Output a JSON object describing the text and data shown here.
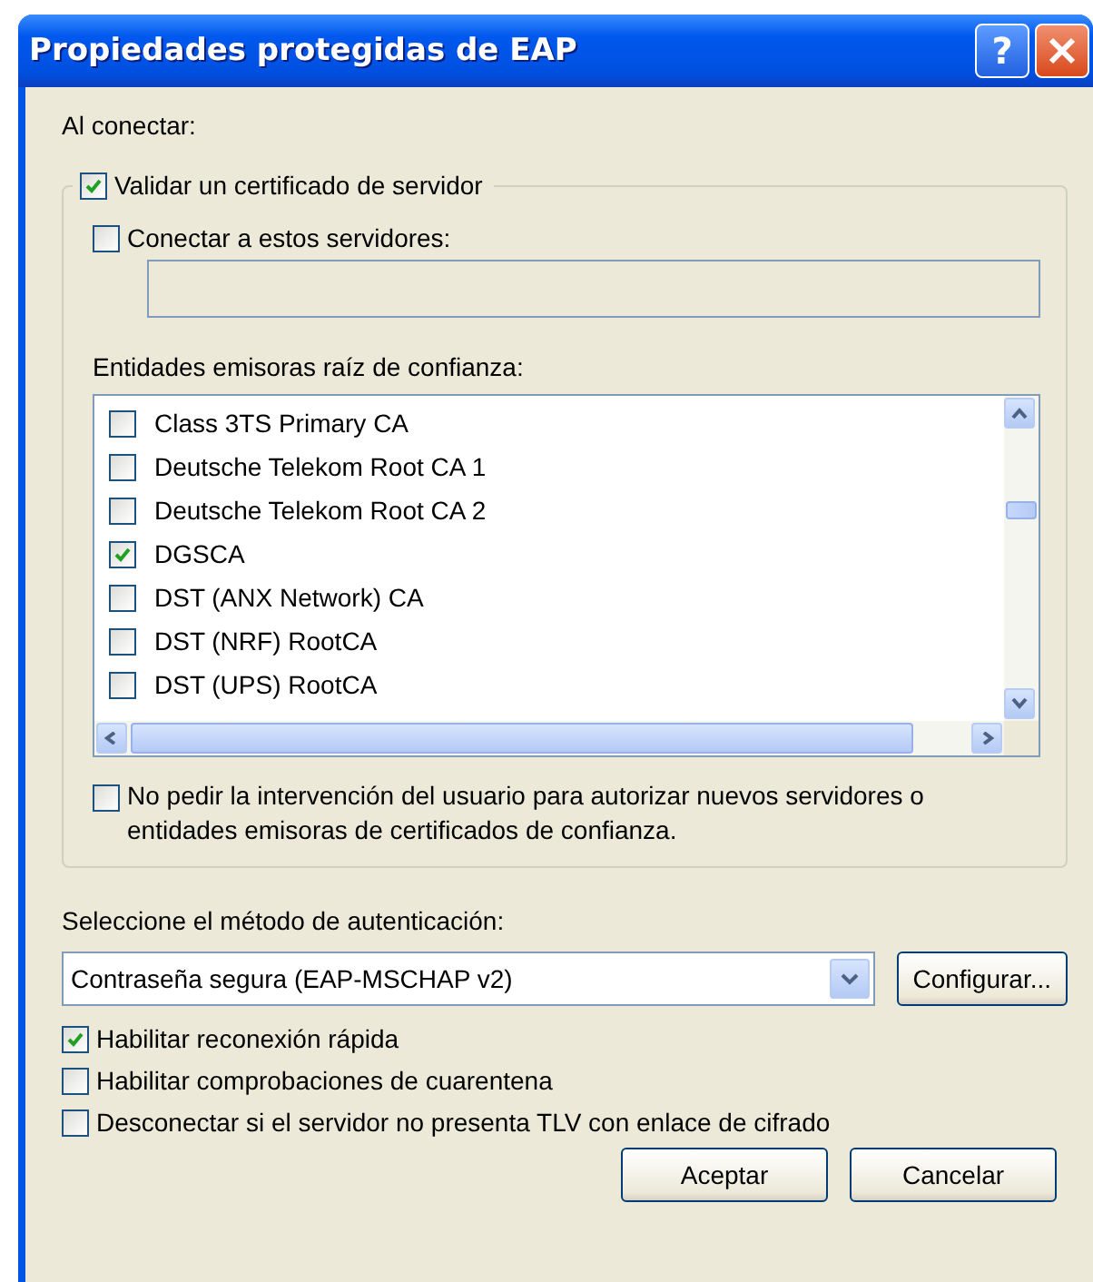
{
  "window": {
    "title": "Propiedades protegidas de EAP",
    "help_button": "?"
  },
  "on_connect_label": "Al conectar:",
  "validate_certificate": {
    "label": "Validar un certificado de servidor",
    "checked": true
  },
  "connect_servers": {
    "label": "Conectar a estos servidores:",
    "checked": false
  },
  "trusted_label": "Entidades emisoras raíz de confianza:",
  "ca_list": [
    {
      "label": "Class 3TS Primary CA",
      "checked": false
    },
    {
      "label": "Deutsche Telekom Root CA 1",
      "checked": false
    },
    {
      "label": "Deutsche Telekom Root CA 2",
      "checked": false
    },
    {
      "label": "DGSCA",
      "checked": true
    },
    {
      "label": "DST (ANX Network) CA",
      "checked": false
    },
    {
      "label": "DST (NRF) RootCA",
      "checked": false
    },
    {
      "label": "DST (UPS) RootCA",
      "checked": false
    }
  ],
  "no_prompt": {
    "label": "No pedir la intervención del usuario para autorizar nuevos servidores o entidades emisoras de certificados de confianza.",
    "checked": false
  },
  "method_label": "Seleccione el método de autenticación:",
  "method_select": {
    "value": "Contraseña segura (EAP-MSCHAP v2)"
  },
  "configure_button": "Configurar...",
  "options": [
    {
      "label": "Habilitar reconexión rápida",
      "checked": true
    },
    {
      "label": "Habilitar comprobaciones de cuarentena",
      "checked": false
    },
    {
      "label": "Desconectar si el servidor no presenta TLV con enlace de cifrado",
      "checked": false
    }
  ],
  "buttons": [
    "Aceptar",
    "Cancelar"
  ]
}
